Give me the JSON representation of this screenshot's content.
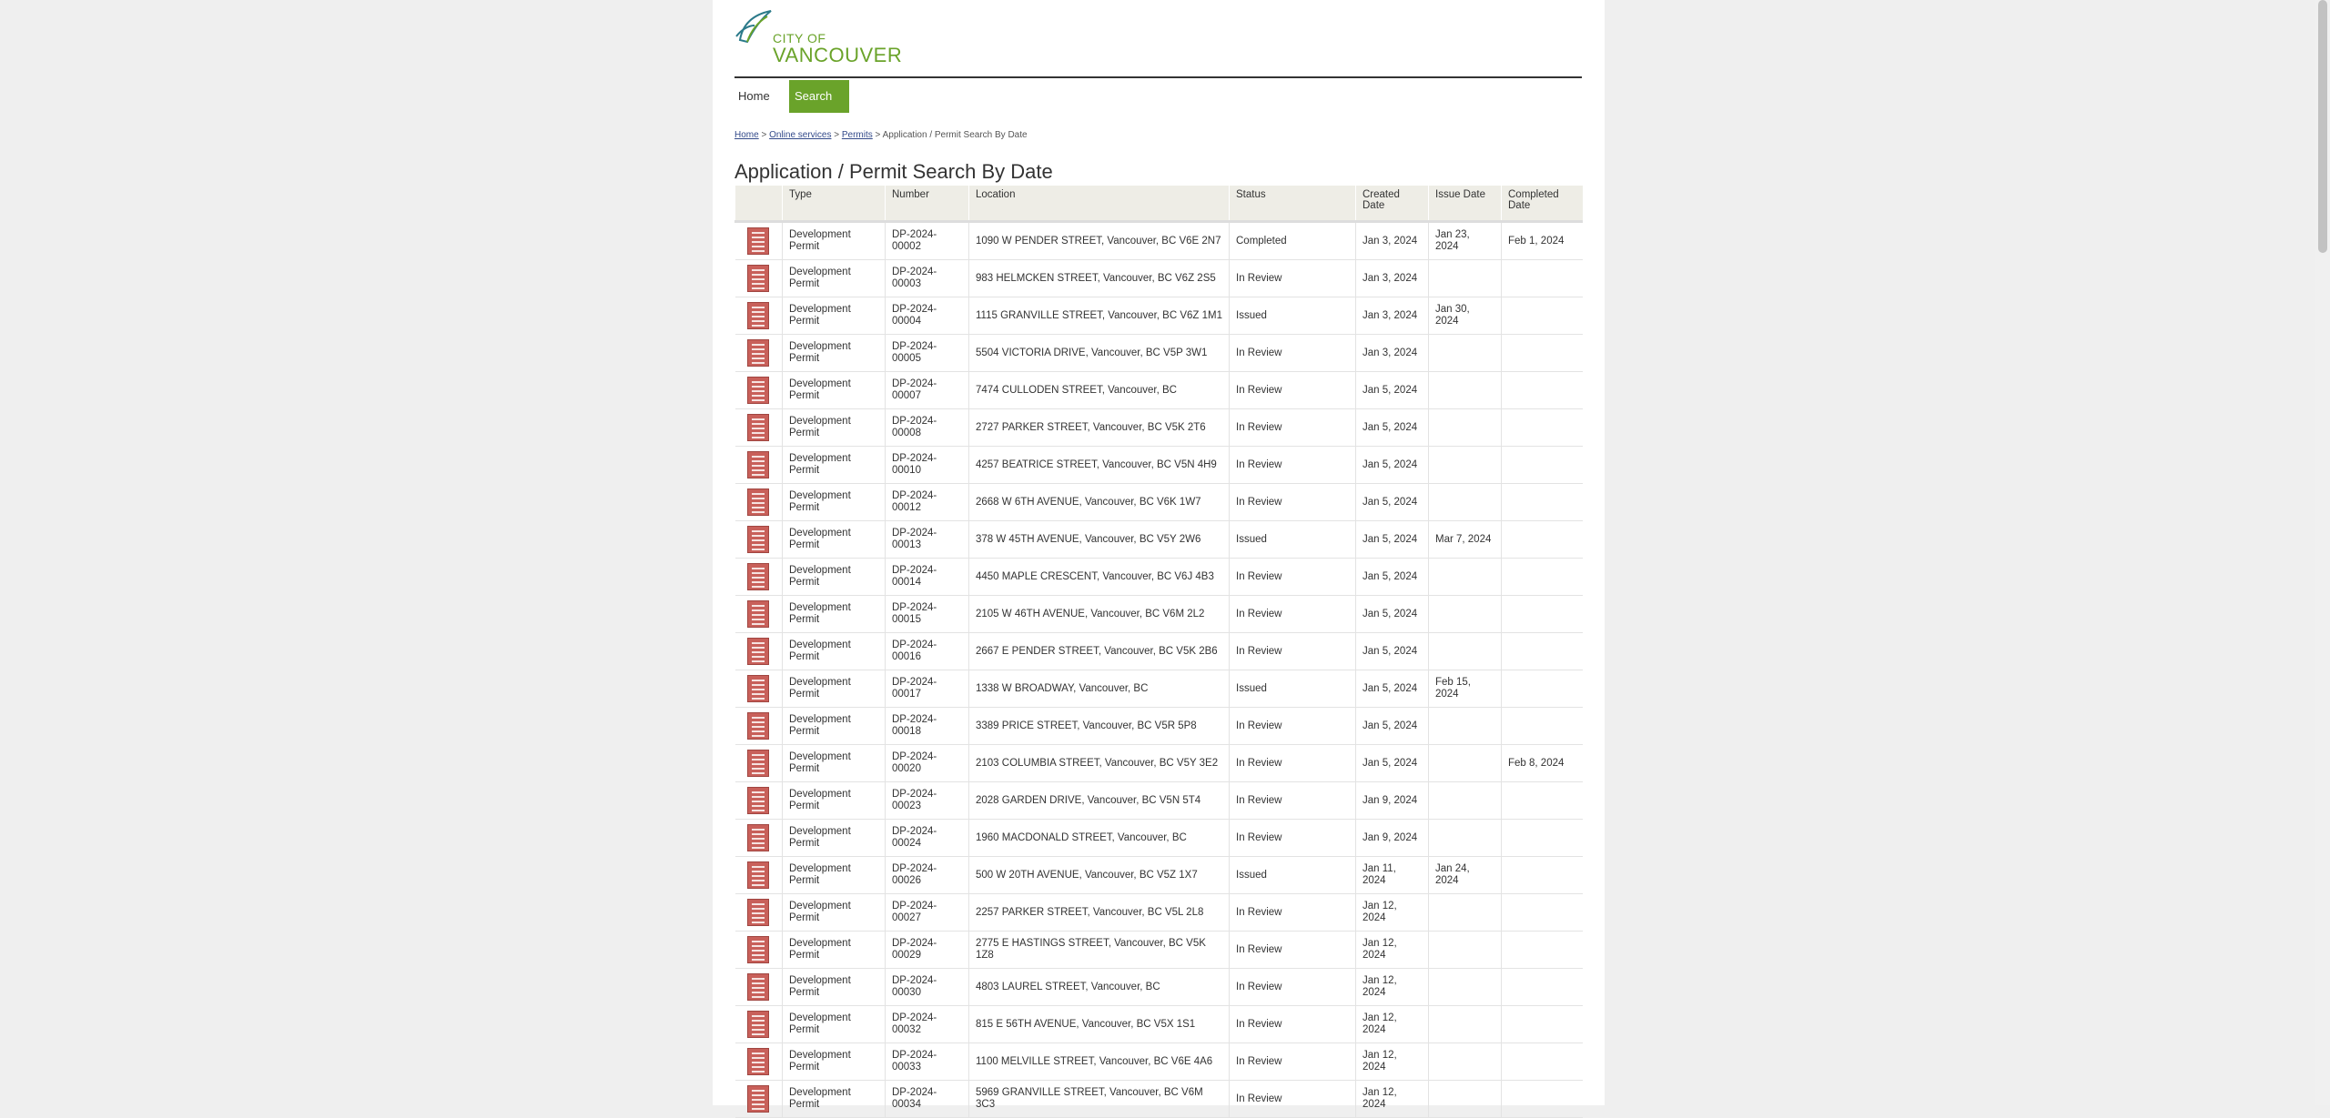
{
  "logo": {
    "line1": "CITY OF",
    "line2": "VANCOUVER",
    "icon": "leaf-icon"
  },
  "nav": {
    "home": "Home",
    "search": "Search"
  },
  "breadcrumb": {
    "home": "Home",
    "sep1": ">",
    "online": "Online services",
    "sep2": ">",
    "permits": "Permits",
    "current": "> Application / Permit Search By Date"
  },
  "page_title": "Application / Permit Search By Date",
  "table": {
    "headers": [
      "",
      "Type",
      "Number",
      "Location",
      "Status",
      "Created Date",
      "Issue Date",
      "Completed Date"
    ],
    "rows": [
      {
        "icon": "document-icon",
        "type": "Development Permit",
        "number": "DP-2024-00002",
        "location": "1090 W PENDER STREET, Vancouver, BC V6E 2N7",
        "status": "Completed",
        "created": "Jan 3, 2024",
        "issue": "Jan 23, 2024",
        "completed": "Feb 1, 2024"
      },
      {
        "icon": "document-icon",
        "type": "Development Permit",
        "number": "DP-2024-00003",
        "location": "983 HELMCKEN STREET, Vancouver, BC V6Z 2S5",
        "status": "In Review",
        "created": "Jan 3, 2024",
        "issue": "",
        "completed": ""
      },
      {
        "icon": "document-icon",
        "type": "Development Permit",
        "number": "DP-2024-00004",
        "location": "1115 GRANVILLE STREET, Vancouver, BC V6Z 1M1",
        "status": "Issued",
        "created": "Jan 3, 2024",
        "issue": "Jan 30, 2024",
        "completed": ""
      },
      {
        "icon": "document-icon",
        "type": "Development Permit",
        "number": "DP-2024-00005",
        "location": "5504 VICTORIA DRIVE, Vancouver, BC V5P 3W1",
        "status": "In Review",
        "created": "Jan 3, 2024",
        "issue": "",
        "completed": ""
      },
      {
        "icon": "document-icon",
        "type": "Development Permit",
        "number": "DP-2024-00007",
        "location": "7474 CULLODEN STREET, Vancouver, BC",
        "status": "In Review",
        "created": "Jan 5, 2024",
        "issue": "",
        "completed": ""
      },
      {
        "icon": "document-icon",
        "type": "Development Permit",
        "number": "DP-2024-00008",
        "location": "2727 PARKER STREET, Vancouver, BC V5K 2T6",
        "status": "In Review",
        "created": "Jan 5, 2024",
        "issue": "",
        "completed": ""
      },
      {
        "icon": "document-icon",
        "type": "Development Permit",
        "number": "DP-2024-00010",
        "location": "4257 BEATRICE STREET, Vancouver, BC V5N 4H9",
        "status": "In Review",
        "created": "Jan 5, 2024",
        "issue": "",
        "completed": ""
      },
      {
        "icon": "document-icon",
        "type": "Development Permit",
        "number": "DP-2024-00012",
        "location": "2668 W 6TH AVENUE, Vancouver, BC V6K 1W7",
        "status": "In Review",
        "created": "Jan 5, 2024",
        "issue": "",
        "completed": ""
      },
      {
        "icon": "document-icon",
        "type": "Development Permit",
        "number": "DP-2024-00013",
        "location": "378 W 45TH AVENUE, Vancouver, BC V5Y 2W6",
        "status": "Issued",
        "created": "Jan 5, 2024",
        "issue": "Mar 7, 2024",
        "completed": ""
      },
      {
        "icon": "document-icon",
        "type": "Development Permit",
        "number": "DP-2024-00014",
        "location": "4450 MAPLE CRESCENT, Vancouver, BC V6J 4B3",
        "status": "In Review",
        "created": "Jan 5, 2024",
        "issue": "",
        "completed": ""
      },
      {
        "icon": "document-icon",
        "type": "Development Permit",
        "number": "DP-2024-00015",
        "location": "2105 W 46TH AVENUE, Vancouver, BC V6M 2L2",
        "status": "In Review",
        "created": "Jan 5, 2024",
        "issue": "",
        "completed": ""
      },
      {
        "icon": "document-icon",
        "type": "Development Permit",
        "number": "DP-2024-00016",
        "location": "2667 E PENDER STREET, Vancouver, BC V5K 2B6",
        "status": "In Review",
        "created": "Jan 5, 2024",
        "issue": "",
        "completed": ""
      },
      {
        "icon": "document-icon",
        "type": "Development Permit",
        "number": "DP-2024-00017",
        "location": "1338 W BROADWAY, Vancouver, BC",
        "status": "Issued",
        "created": "Jan 5, 2024",
        "issue": "Feb 15, 2024",
        "completed": ""
      },
      {
        "icon": "document-icon",
        "type": "Development Permit",
        "number": "DP-2024-00018",
        "location": "3389 PRICE STREET, Vancouver, BC V5R 5P8",
        "status": "In Review",
        "created": "Jan 5, 2024",
        "issue": "",
        "completed": ""
      },
      {
        "icon": "document-icon",
        "type": "Development Permit",
        "number": "DP-2024-00020",
        "location": "2103 COLUMBIA STREET, Vancouver, BC V5Y 3E2",
        "status": "In Review",
        "created": "Jan 5, 2024",
        "issue": "",
        "completed": "Feb 8, 2024"
      },
      {
        "icon": "document-icon",
        "type": "Development Permit",
        "number": "DP-2024-00023",
        "location": "2028 GARDEN DRIVE, Vancouver, BC V5N 5T4",
        "status": "In Review",
        "created": "Jan 9, 2024",
        "issue": "",
        "completed": ""
      },
      {
        "icon": "document-icon",
        "type": "Development Permit",
        "number": "DP-2024-00024",
        "location": "1960 MACDONALD STREET, Vancouver, BC",
        "status": "In Review",
        "created": "Jan 9, 2024",
        "issue": "",
        "completed": ""
      },
      {
        "icon": "document-icon",
        "type": "Development Permit",
        "number": "DP-2024-00026",
        "location": "500 W 20TH AVENUE, Vancouver, BC V5Z 1X7",
        "status": "Issued",
        "created": "Jan 11, 2024",
        "issue": "Jan 24, 2024",
        "completed": ""
      },
      {
        "icon": "document-icon",
        "type": "Development Permit",
        "number": "DP-2024-00027",
        "location": "2257 PARKER STREET, Vancouver, BC V5L 2L8",
        "status": "In Review",
        "created": "Jan 12, 2024",
        "issue": "",
        "completed": ""
      },
      {
        "icon": "document-icon",
        "type": "Development Permit",
        "number": "DP-2024-00029",
        "location": "2775 E HASTINGS STREET, Vancouver, BC V5K 1Z8",
        "status": "In Review",
        "created": "Jan 12, 2024",
        "issue": "",
        "completed": ""
      },
      {
        "icon": "document-icon",
        "type": "Development Permit",
        "number": "DP-2024-00030",
        "location": "4803 LAUREL STREET, Vancouver, BC",
        "status": "In Review",
        "created": "Jan 12, 2024",
        "issue": "",
        "completed": ""
      },
      {
        "icon": "document-icon",
        "type": "Development Permit",
        "number": "DP-2024-00032",
        "location": "815 E 56TH AVENUE, Vancouver, BC V5X 1S1",
        "status": "In Review",
        "created": "Jan 12, 2024",
        "issue": "",
        "completed": ""
      },
      {
        "icon": "document-icon",
        "type": "Development Permit",
        "number": "DP-2024-00033",
        "location": "1100 MELVILLE STREET, Vancouver, BC V6E 4A6",
        "status": "In Review",
        "created": "Jan 12, 2024",
        "issue": "",
        "completed": ""
      },
      {
        "icon": "document-icon",
        "type": "Development Permit",
        "number": "DP-2024-00034",
        "location": "5969 GRANVILLE STREET, Vancouver, BC V6M 3C3",
        "status": "In Review",
        "created": "Jan 12, 2024",
        "issue": "",
        "completed": ""
      }
    ]
  },
  "colors": {
    "accent": "#6aa32a",
    "header_bg": "#eeede6",
    "icon": "#c8605a"
  }
}
